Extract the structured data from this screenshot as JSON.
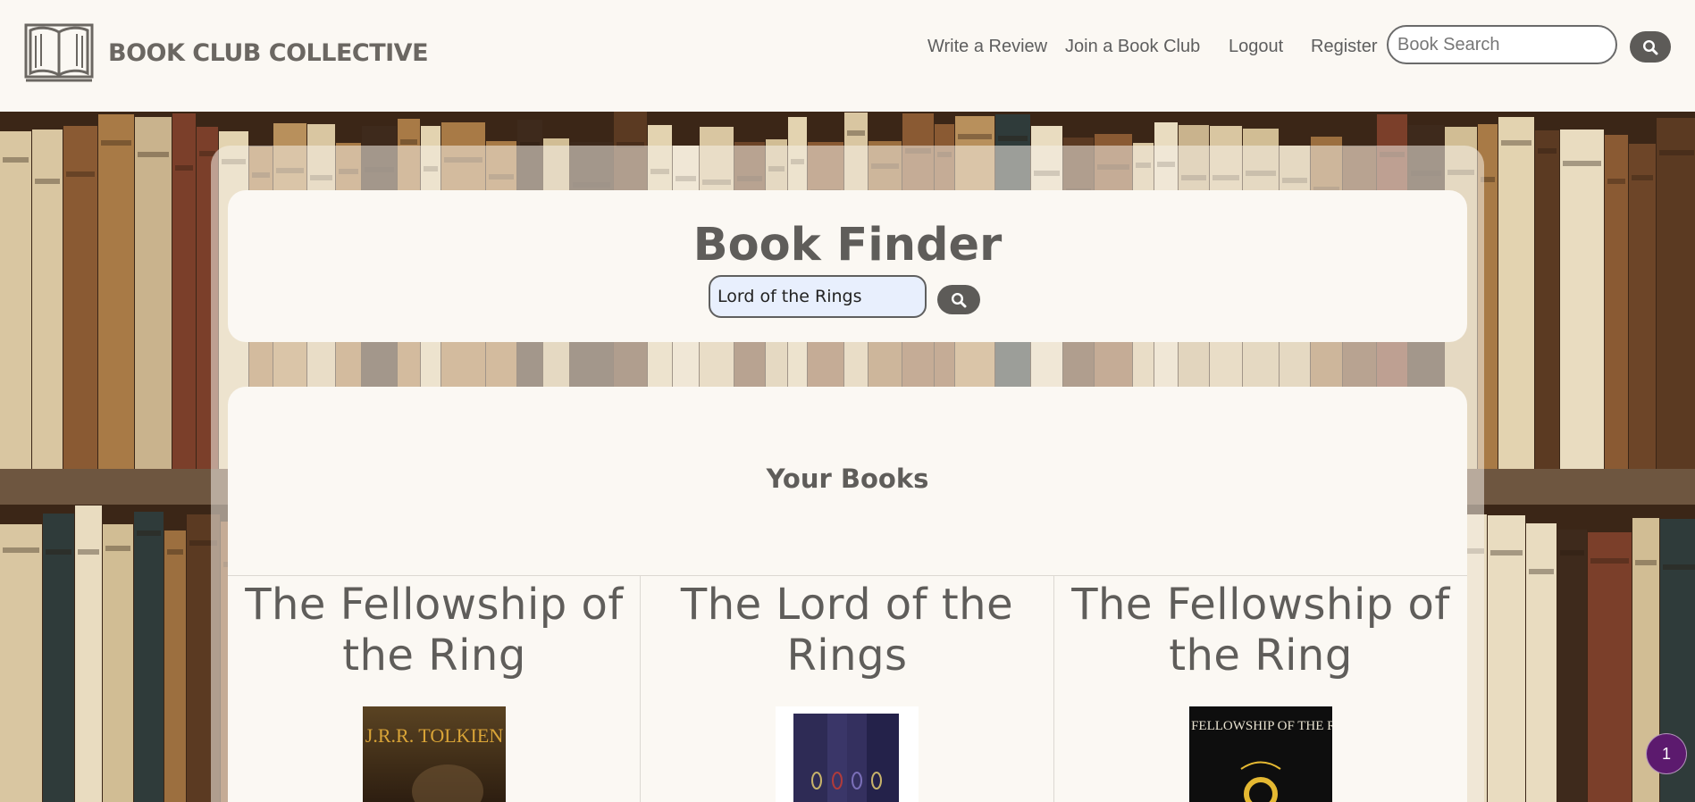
{
  "header": {
    "brand": "BOOK CLUB COLLECTIVE",
    "nav": [
      {
        "label": "Write a Review"
      },
      {
        "label": "Join a Book Club"
      },
      {
        "label": "Logout"
      },
      {
        "label": "Register"
      }
    ],
    "search_placeholder": "Book Search",
    "search_icon": "search-icon"
  },
  "finder": {
    "title": "Book Finder",
    "query_value": "Lord of the Rings",
    "search_icon": "search-icon"
  },
  "books": {
    "heading": "Your Books",
    "items": [
      {
        "title": "The Fellowship of the Ring",
        "cover_text": "J.R.R. TOLKIEN"
      },
      {
        "title": "The Lord of the Rings",
        "cover_text": ""
      },
      {
        "title": "The Fellowship of the Ring",
        "cover_text": "THE FELLOWSHIP OF THE RING"
      }
    ]
  },
  "notification": {
    "count": "1"
  },
  "colors": {
    "header_bg": "#fbf8f3",
    "text": "#5f5d5a",
    "button": "#5d5b58",
    "input_bg": "#e8effd",
    "badge": "#5c1a6e"
  }
}
